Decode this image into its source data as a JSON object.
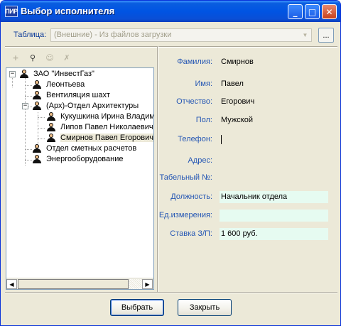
{
  "window": {
    "icon_text": "ПИР",
    "title": "Выбор исполнителя",
    "minimize_glyph": "_",
    "maximize_glyph": "□",
    "close_glyph": "✕"
  },
  "table": {
    "label": "Таблица:",
    "value": "(Внешние) - Из файлов загрузки",
    "dropdown_arrow": "▼",
    "browse_label": "..."
  },
  "toolbar": {
    "icons": [
      {
        "name": "add-icon",
        "glyph": "+",
        "enabled": false
      },
      {
        "name": "find-icon",
        "glyph": "⚲",
        "enabled": true
      },
      {
        "name": "add-person-icon",
        "glyph": "☺",
        "enabled": false
      },
      {
        "name": "remove-person-icon",
        "glyph": "✗",
        "enabled": false
      }
    ]
  },
  "tree": {
    "root": {
      "label": "ЗАО \"ИнвестГаз\"",
      "expand": "−"
    },
    "items": [
      {
        "label": "Леонтьева"
      },
      {
        "label": "Вентиляция шахт"
      },
      {
        "label": "(Арх)-Отдел Архитектуры",
        "expand": "−"
      },
      {
        "label": "Кукушкина Ирина Владимировна"
      },
      {
        "label": "Липов Павел Николаевич"
      },
      {
        "label": "Смирнов Павел Егорович"
      },
      {
        "label": "Отдел сметных расчетов"
      },
      {
        "label": "Энергооборудование"
      }
    ],
    "scroll_left": "◀",
    "scroll_right": "▶"
  },
  "fields": {
    "last_name": {
      "label": "Фамилия:",
      "value": "Смирнов"
    },
    "first_name": {
      "label": "Имя:",
      "value": "Павел"
    },
    "patronymic": {
      "label": "Отчество:",
      "value": "Егорович"
    },
    "gender": {
      "label": "Пол:",
      "value": "Мужской"
    },
    "phone": {
      "label": "Телефон:",
      "value": ""
    },
    "address": {
      "label": "Адрес:",
      "value": ""
    },
    "tab_number": {
      "label": "Табельный №:",
      "value": ""
    },
    "position": {
      "label": "Должность:",
      "value": "Начальник отдела"
    },
    "unit": {
      "label": "Ед.измерения:",
      "value": ""
    },
    "rate": {
      "label": "Ставка З/П:",
      "value": "1 600 руб."
    }
  },
  "buttons": {
    "select": "Выбрать",
    "close": "Закрыть"
  },
  "colors": {
    "label_blue": "#2456b4",
    "highlight_field": "#e6fbf1",
    "title_bar": "#0054e3"
  }
}
